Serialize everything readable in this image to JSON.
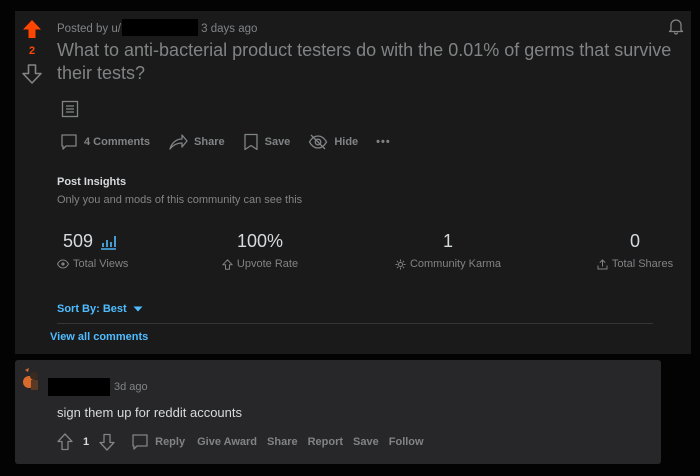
{
  "post": {
    "score": "2",
    "posted_by": "Posted by u/",
    "age": "3 days ago",
    "title": "What to anti-bacterial product testers do with the 0.01% of germs that survive their tests?",
    "actions": {
      "comments": "4 Comments",
      "share": "Share",
      "save": "Save",
      "hide": "Hide",
      "more": "•••"
    }
  },
  "insights": {
    "title": "Post Insights",
    "subtitle": "Only you and mods of this community can see this",
    "stats": [
      {
        "value": "509",
        "label": "Total Views"
      },
      {
        "value": "100%",
        "label": "Upvote Rate"
      },
      {
        "value": "1",
        "label": "Community Karma"
      },
      {
        "value": "0",
        "label": "Total Shares"
      }
    ]
  },
  "sort": {
    "label": "Sort By: Best"
  },
  "view_all": "View all comments",
  "comment": {
    "age": "3d ago",
    "body": "sign them up for reddit accounts",
    "score": "1",
    "actions": {
      "reply": "Reply",
      "award": "Give Award",
      "share": "Share",
      "report": "Report",
      "save": "Save",
      "follow": "Follow"
    }
  },
  "colors": {
    "upvote": "#ff4500",
    "link": "#4fbcff",
    "card": "#1a1a1b",
    "muted": "#818384"
  }
}
